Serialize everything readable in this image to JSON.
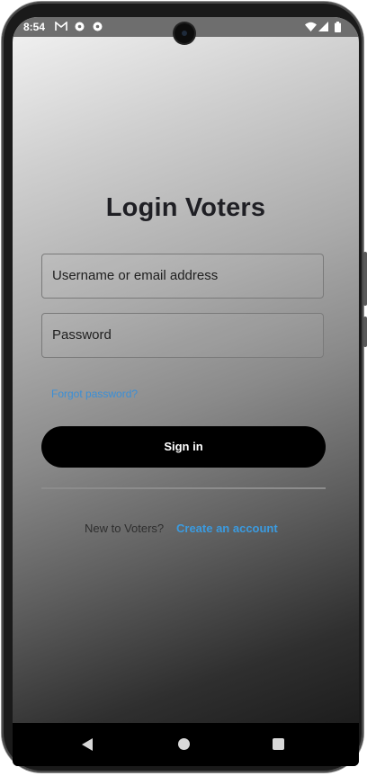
{
  "status_bar": {
    "time": "8:54",
    "left_icons": [
      "gmail-icon",
      "soccer-ball-icon",
      "soccer-ball-icon"
    ],
    "right_icons": [
      "wifi-icon",
      "cell-signal-icon",
      "battery-icon"
    ]
  },
  "login": {
    "title": "Login Voters",
    "username_placeholder": "Username or email address",
    "password_placeholder": "Password",
    "forgot_label": "Forgot password?",
    "signin_label": "Sign in",
    "new_prompt": "New to Voters?",
    "create_label": "Create an account"
  },
  "nav_bar": {
    "buttons": [
      "back",
      "home",
      "recents"
    ]
  },
  "colors": {
    "link": "#3b8fd6",
    "button_bg": "#000000",
    "button_text": "#ffffff",
    "title": "#1f1f24"
  }
}
